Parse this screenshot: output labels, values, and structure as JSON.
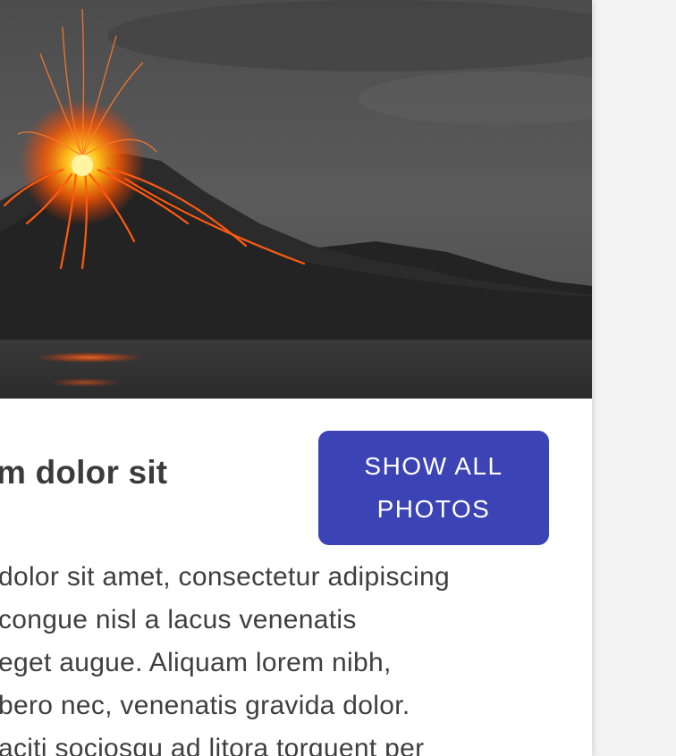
{
  "hero": {
    "icon": "volcano-photo",
    "colors": {
      "sky": "#575757",
      "mountain": "#262626",
      "lava": "#ff6a00"
    }
  },
  "article": {
    "title_fragment": "m dolor sit",
    "cta_label": "SHOW ALL PHOTOS",
    "body_lines": [
      "dolor sit amet, consectetur adipiscing",
      "congue nisl a lacus venenatis",
      "eget augue. Aliquam lorem nibh,",
      "bero nec, venenatis gravida dolor.",
      "aciti sociosqu ad litora torquent per"
    ]
  },
  "colors": {
    "accent": "#3c43b4",
    "page_bg": "#f3f3f3",
    "card_bg": "#ffffff",
    "text": "#3f3f3f"
  }
}
